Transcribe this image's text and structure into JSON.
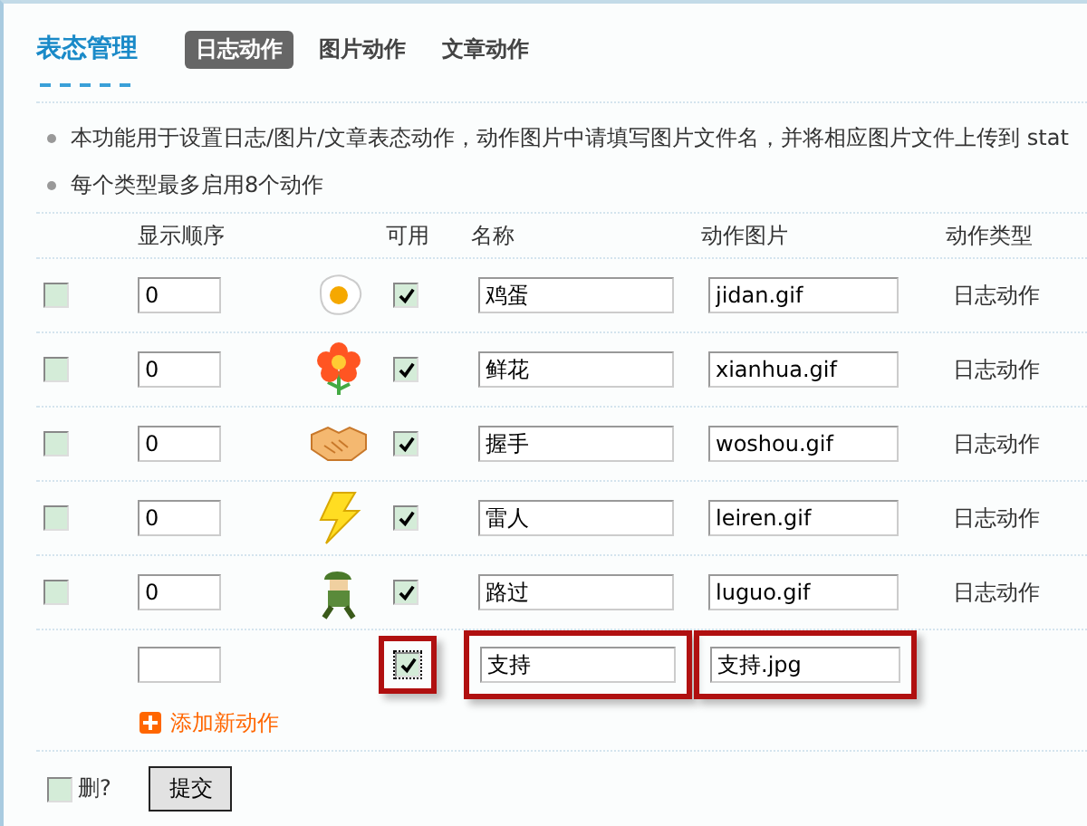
{
  "header": {
    "title": "表态管理",
    "tabs": [
      {
        "label": "日志动作",
        "selected": true
      },
      {
        "label": "图片动作",
        "selected": false
      },
      {
        "label": "文章动作",
        "selected": false
      }
    ]
  },
  "notes": [
    "本功能用于设置日志/图片/文章表态动作，动作图片中请填写图片文件名，并将相应图片文件上传到  stat",
    "每个类型最多启用8个动作"
  ],
  "table": {
    "columns": [
      "显示顺序",
      "可用",
      "名称",
      "动作图片",
      "动作类型"
    ],
    "rows": [
      {
        "delete": false,
        "order": "0",
        "kind": "egg",
        "enabled": true,
        "name": "鸡蛋",
        "image": "jidan.gif",
        "type": "日志动作"
      },
      {
        "delete": false,
        "order": "0",
        "kind": "flower",
        "enabled": true,
        "name": "鲜花",
        "image": "xianhua.gif",
        "type": "日志动作"
      },
      {
        "delete": false,
        "order": "0",
        "kind": "handshake",
        "enabled": true,
        "name": "握手",
        "image": "woshou.gif",
        "type": "日志动作"
      },
      {
        "delete": false,
        "order": "0",
        "kind": "lightning",
        "enabled": true,
        "name": "雷人",
        "image": "leiren.gif",
        "type": "日志动作"
      },
      {
        "delete": false,
        "order": "0",
        "kind": "soldier",
        "enabled": true,
        "name": "路过",
        "image": "luguo.gif",
        "type": "日志动作"
      }
    ],
    "new_row": {
      "enabled": true,
      "name": "支持",
      "image": "支持.jpg",
      "highlighted": true
    }
  },
  "add_link": "添加新动作",
  "footer": {
    "delete_checked": false,
    "delete_label": "删?",
    "submit": "提交"
  }
}
